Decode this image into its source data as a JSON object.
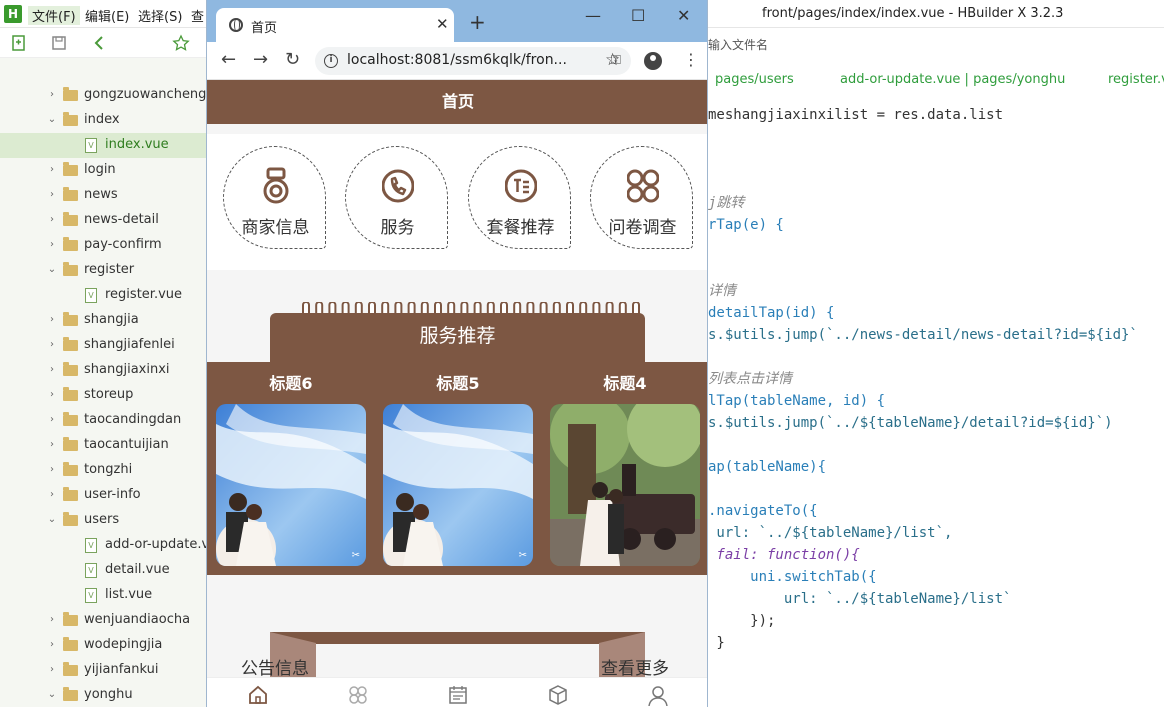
{
  "ide": {
    "logo": "H",
    "menus": [
      "文件(F)",
      "编辑(E)",
      "选择(S)",
      "查"
    ],
    "window_title": "front/pages/index/index.vue - HBuilder X 3.2.3",
    "search_placeholder": "输入文件名",
    "editor_tabs": [
      "pages/users",
      "add-or-update.vue | pages/yonghu",
      "register.v"
    ],
    "tree": [
      {
        "label": "gongzuowancheng",
        "type": "folder",
        "expanded": false,
        "indent": 0
      },
      {
        "label": "index",
        "type": "folder",
        "expanded": true,
        "indent": 0
      },
      {
        "label": "index.vue",
        "type": "file",
        "indent": 1,
        "selected": true
      },
      {
        "label": "login",
        "type": "folder",
        "expanded": false,
        "indent": 0
      },
      {
        "label": "news",
        "type": "folder",
        "expanded": false,
        "indent": 0
      },
      {
        "label": "news-detail",
        "type": "folder",
        "expanded": false,
        "indent": 0
      },
      {
        "label": "pay-confirm",
        "type": "folder",
        "expanded": false,
        "indent": 0
      },
      {
        "label": "register",
        "type": "folder",
        "expanded": true,
        "indent": 0
      },
      {
        "label": "register.vue",
        "type": "file",
        "indent": 1
      },
      {
        "label": "shangjia",
        "type": "folder",
        "expanded": false,
        "indent": 0
      },
      {
        "label": "shangjiafenlei",
        "type": "folder",
        "expanded": false,
        "indent": 0
      },
      {
        "label": "shangjiaxinxi",
        "type": "folder",
        "expanded": false,
        "indent": 0
      },
      {
        "label": "storeup",
        "type": "folder",
        "expanded": false,
        "indent": 0
      },
      {
        "label": "taocandingdan",
        "type": "folder",
        "expanded": false,
        "indent": 0
      },
      {
        "label": "taocantuijian",
        "type": "folder",
        "expanded": false,
        "indent": 0
      },
      {
        "label": "tongzhi",
        "type": "folder",
        "expanded": false,
        "indent": 0
      },
      {
        "label": "user-info",
        "type": "folder",
        "expanded": false,
        "indent": 0
      },
      {
        "label": "users",
        "type": "folder",
        "expanded": true,
        "indent": 0
      },
      {
        "label": "add-or-update.vu",
        "type": "file",
        "indent": 1
      },
      {
        "label": "detail.vue",
        "type": "file",
        "indent": 1
      },
      {
        "label": "list.vue",
        "type": "file",
        "indent": 1
      },
      {
        "label": "wenjuandiaocha",
        "type": "folder",
        "expanded": false,
        "indent": 0
      },
      {
        "label": "wodepingjia",
        "type": "folder",
        "expanded": false,
        "indent": 0
      },
      {
        "label": "yijianfankui",
        "type": "folder",
        "expanded": false,
        "indent": 0
      },
      {
        "label": "yonghu",
        "type": "folder",
        "expanded": true,
        "indent": 0
      }
    ],
    "code_lines": [
      {
        "text": "meshangjiaxinxilist = res.data.list",
        "cls": ""
      },
      {
        "text": "",
        "cls": ""
      },
      {
        "text": "",
        "cls": ""
      },
      {
        "text": "",
        "cls": ""
      },
      {
        "text": "j跳转",
        "cls": "c-comment"
      },
      {
        "text": "rTap(e) {",
        "cls": "c-fn"
      },
      {
        "text": "",
        "cls": ""
      },
      {
        "text": "",
        "cls": ""
      },
      {
        "text": "详情",
        "cls": "c-comment"
      },
      {
        "text": "detailTap(id) {",
        "cls": "c-fn"
      },
      {
        "text": "s.$utils.jump(`../news-detail/news-detail?id=${id}`",
        "cls": "c-str"
      },
      {
        "text": "",
        "cls": ""
      },
      {
        "text": "列表点击详情",
        "cls": "c-comment"
      },
      {
        "text": "lTap(tableName, id) {",
        "cls": "c-fn"
      },
      {
        "text": "s.$utils.jump(`../${tableName}/detail?id=${id}`)",
        "cls": "c-str"
      },
      {
        "text": "",
        "cls": ""
      },
      {
        "text": "ap(tableName){",
        "cls": "c-fn"
      },
      {
        "text": "",
        "cls": ""
      },
      {
        "text": ".navigateTo({",
        "cls": "c-fn"
      },
      {
        "text": " url: `../${tableName}/list`,",
        "cls": "c-str"
      },
      {
        "text": " fail: function(){",
        "cls": "c-kw"
      },
      {
        "text": "     uni.switchTab({",
        "cls": "c-fn"
      },
      {
        "text": "         url: `../${tableName}/list`",
        "cls": "c-str"
      },
      {
        "text": "     });",
        "cls": ""
      },
      {
        "text": " }",
        "cls": ""
      }
    ]
  },
  "browser": {
    "tab_title": "首页",
    "url": "localhost:8081/ssm6kqlk/fron...",
    "minimize": "—",
    "maximize": "☐",
    "close": "✕"
  },
  "app": {
    "header_title": "首页",
    "nav_items": [
      {
        "label": "商家信息",
        "icon": "medal-icon"
      },
      {
        "label": "服务",
        "icon": "phone-icon"
      },
      {
        "label": "套餐推荐",
        "icon": "text-circle-icon"
      },
      {
        "label": "问卷调查",
        "icon": "grid-circles-icon"
      }
    ],
    "section_title": "服务推荐",
    "cards": [
      {
        "title": "标题6",
        "image": "wedding-couple-veil"
      },
      {
        "title": "标题5",
        "image": "wedding-couple-veil"
      },
      {
        "title": "标题4",
        "image": "wedding-couple-train"
      }
    ],
    "notice_title": "公告信息",
    "notice_more": "查看更多",
    "tabbar_icons": [
      "home-icon",
      "category-icon",
      "calendar-icon",
      "box-icon",
      "user-icon"
    ]
  },
  "colors": {
    "brand": "#7d5743",
    "ide_accent": "#3a9a2d",
    "browser_frame": "#8fb8e0"
  }
}
